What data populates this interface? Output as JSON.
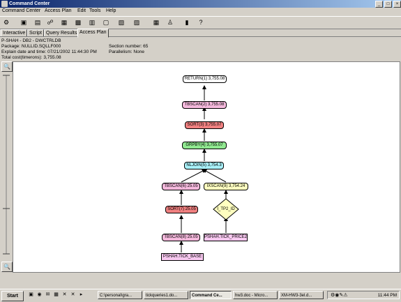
{
  "window": {
    "title": "Command Center"
  },
  "menu": [
    "Command Center",
    "Access Plan",
    "Edit",
    "Tools",
    "Help"
  ],
  "tabs": [
    "Interactive",
    "Script",
    "Query Results",
    "Access Plan"
  ],
  "info": {
    "db": "P-SHAH - DB2 - DWCTRLDB",
    "package": "Package: NULLID.SQLLF000",
    "explain": "Explain date and time: 07/21/2002 11:44:30 PM",
    "cost": "Total cost(timerons): 3,755.08",
    "section": "Section number: 65",
    "parallelism": "Parallelism: None"
  },
  "plan": {
    "return": "RETURN(1) 3,755.08",
    "tbscan2": "TBSCAN(2) 3,755.08",
    "sort3": "SORT(3) 3,755.07",
    "grpby4": "GRPBY(4) 3,755.07",
    "nljoin5": "NLJOIN(5) 3,754.3",
    "tbscan6": "TBSCAN(6) 25.05",
    "ixscan9": "IXSCAN(9) 3,754.24",
    "sort7": "SORT(7) 25.05",
    "index": "I_TP2_ID",
    "tbscan8": "TBSCAN(8) 25.05",
    "table_base": "PSHAH.TICK_BASE",
    "table_price": "PSHAH.TICK_PRICE2"
  },
  "colors": {
    "return": "#ffffff",
    "pink": "#f4b8dc",
    "red": "#f08080",
    "green": "#90e890",
    "cyan": "#a8f0f8",
    "yellow": "#ffffc0",
    "table": "#f8c8f0"
  },
  "taskbar": {
    "start": "Start",
    "tasks": [
      "C:\\personal\\gra...",
      "tickqueries1.do...",
      "Command Ce...",
      "hw3.doc - Micro...",
      "XM-HW3-3el.d..."
    ],
    "clock": "11:44 PM"
  }
}
